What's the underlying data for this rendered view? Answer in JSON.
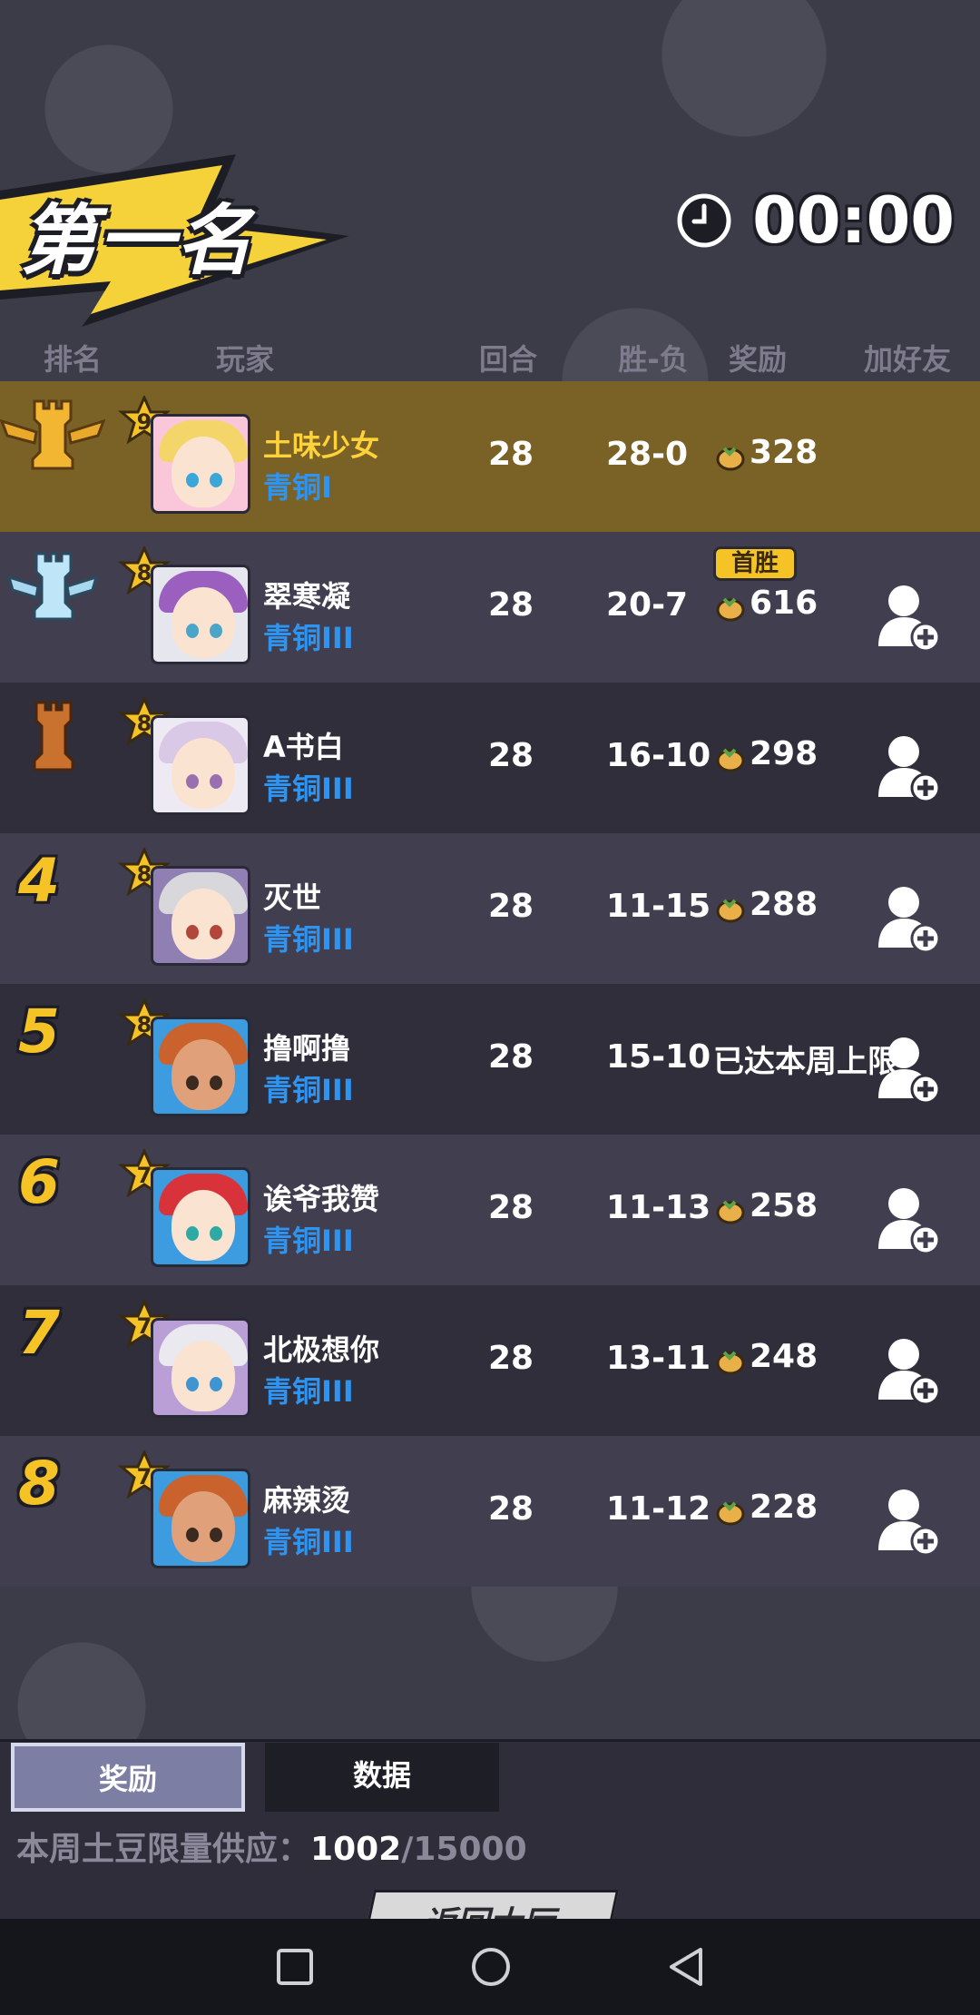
{
  "header": {
    "title": "第一名",
    "timer": "00:00"
  },
  "columns": {
    "rank": "排名",
    "player": "玩家",
    "rounds": "回合",
    "win_loss": "胜-负",
    "reward": "奖励",
    "add_friend": "加好友"
  },
  "players": [
    {
      "rank": "1",
      "level": "9",
      "name": "土味少女",
      "tier": "青铜I",
      "rounds": "28",
      "win_loss": "28-0",
      "reward": "328",
      "first_win": "",
      "limit_text": "",
      "hair": "#f4d56a",
      "eye": "#3aa7d8"
    },
    {
      "rank": "2",
      "level": "8",
      "name": "翠寒凝",
      "tier": "青铜III",
      "rounds": "28",
      "win_loss": "20-7",
      "reward": "616",
      "first_win": "首胜",
      "limit_text": "",
      "hair": "#9b5fc0",
      "eye": "#4aa5c9"
    },
    {
      "rank": "3",
      "level": "8",
      "name": "A书白",
      "tier": "青铜III",
      "rounds": "28",
      "win_loss": "16-10",
      "reward": "298",
      "first_win": "",
      "limit_text": "",
      "hair": "#d9c8e6",
      "eye": "#9a6fb0"
    },
    {
      "rank": "4",
      "level": "8",
      "name": "灭世",
      "tier": "青铜III",
      "rounds": "28",
      "win_loss": "11-15",
      "reward": "288",
      "first_win": "",
      "limit_text": "",
      "hair": "#d8d8dc",
      "eye": "#b3463a"
    },
    {
      "rank": "5",
      "level": "8",
      "name": "撸啊撸",
      "tier": "青铜III",
      "rounds": "28",
      "win_loss": "15-10",
      "reward": "",
      "first_win": "",
      "limit_text": "已达本周上限",
      "hair": "#c9622c",
      "eye": "#3a2a20"
    },
    {
      "rank": "6",
      "level": "7",
      "name": "诶爷我赞",
      "tier": "青铜III",
      "rounds": "28",
      "win_loss": "11-13",
      "reward": "258",
      "first_win": "",
      "limit_text": "",
      "hair": "#d8333a",
      "eye": "#2fa9a3"
    },
    {
      "rank": "7",
      "level": "7",
      "name": "北极想你",
      "tier": "青铜III",
      "rounds": "28",
      "win_loss": "13-11",
      "reward": "248",
      "first_win": "",
      "limit_text": "",
      "hair": "#e9e9ef",
      "eye": "#3f94d1"
    },
    {
      "rank": "8",
      "level": "7",
      "name": "麻辣烫",
      "tier": "青铜III",
      "rounds": "28",
      "win_loss": "11-12",
      "reward": "228",
      "first_win": "",
      "limit_text": "",
      "hair": "#c9622c",
      "eye": "#3a2a20"
    }
  ],
  "tabs": {
    "reward": "奖励",
    "data": "数据"
  },
  "supply": {
    "label": "本周土豆限量供应：",
    "current": "1002",
    "max": "/15000"
  },
  "back_button": "返回大厅",
  "colors": {
    "gold": "#f6c326",
    "tier_blue": "#2f93f0",
    "first_row": "#7a6226"
  }
}
